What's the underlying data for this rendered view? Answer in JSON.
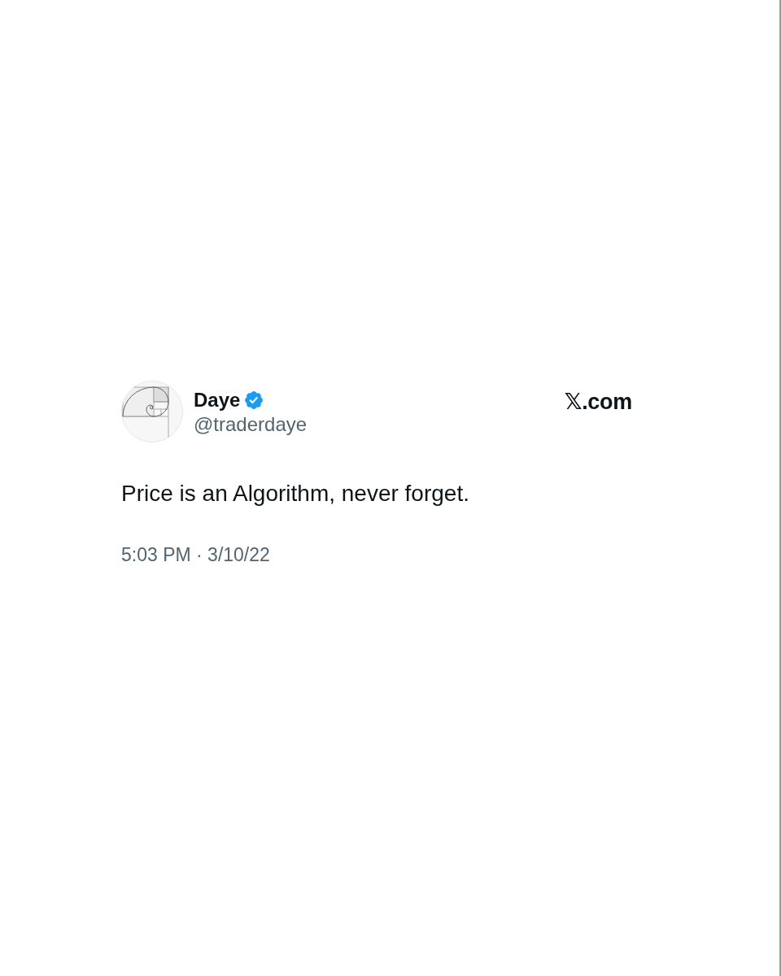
{
  "author": {
    "name": "Daye",
    "verified": true,
    "handle": "@traderdaye"
  },
  "site": "𝕏.com",
  "tweet": {
    "text": "Price is an Algorithm, never forget.",
    "timestamp": "5:03 PM · 3/10/22"
  }
}
